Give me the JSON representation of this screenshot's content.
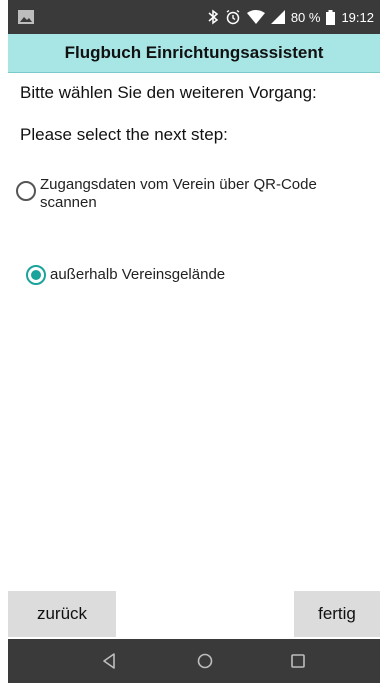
{
  "status_bar": {
    "battery": "80 %",
    "time": "19:12",
    "icons": [
      "image-icon",
      "bluetooth-icon",
      "alarm-icon",
      "wifi-icon",
      "signal-icon",
      "battery-icon"
    ]
  },
  "title": "Flugbuch Einrichtungsassistent",
  "prompt_de": "Bitte wählen Sie den weiteren Vorgang:",
  "prompt_en": "Please select the next step:",
  "options": [
    {
      "label": "Zugangsdaten vom Verein über QR-Code scannen",
      "selected": false
    },
    {
      "label": "außerhalb Vereinsgelände",
      "selected": true
    }
  ],
  "buttons": {
    "back": "zurück",
    "done": "fertig"
  },
  "colors": {
    "title_bar": "#a8e6e6",
    "accent": "#1aa39a",
    "system_bar": "#3a3a3a",
    "button_bg": "#dcdcdc"
  },
  "nav": [
    "back-icon",
    "home-icon",
    "recent-apps-icon"
  ]
}
